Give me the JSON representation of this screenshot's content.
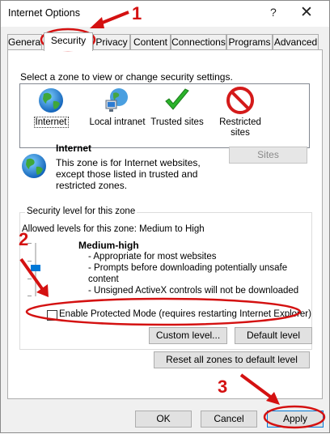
{
  "window": {
    "title": "Internet Options",
    "help_glyph": "?",
    "close_glyph": "✕"
  },
  "tabs": [
    {
      "label": "General"
    },
    {
      "label": "Security",
      "active": true
    },
    {
      "label": "Privacy"
    },
    {
      "label": "Content"
    },
    {
      "label": "Connections"
    },
    {
      "label": "Programs"
    },
    {
      "label": "Advanced"
    }
  ],
  "security": {
    "instruction": "Select a zone to view or change security settings.",
    "zones": [
      {
        "label": "Internet",
        "icon": "globe-icon",
        "selected": true
      },
      {
        "label": "Local intranet",
        "icon": "network-icon"
      },
      {
        "label": "Trusted sites",
        "icon": "checkmark-icon"
      },
      {
        "label_line1": "Restricted",
        "label_line2": "sites",
        "icon": "restricted-icon"
      }
    ],
    "zone_info": {
      "title": "Internet",
      "desc_line1": "This zone is for Internet websites,",
      "desc_line2": "except those listed in trusted and",
      "desc_line3": "restricted zones."
    },
    "sites_button": "Sites",
    "level_group": {
      "title": "Security level for this zone",
      "allowed": "Allowed levels for this zone: Medium to High",
      "level_name": "Medium-high",
      "bullets": [
        "- Appropriate for most websites",
        "- Prompts before downloading potentially unsafe",
        "content",
        "- Unsigned ActiveX controls will not be downloaded"
      ]
    },
    "protected_mode": {
      "label": "Enable Protected Mode (requires restarting Internet Explorer)",
      "checked": false
    },
    "custom_level_button": "Custom level...",
    "default_level_button": "Default level",
    "reset_all_button": "Reset all zones to default level"
  },
  "footer": {
    "ok": "OK",
    "cancel": "Cancel",
    "apply": "Apply"
  },
  "annotations": {
    "step1": "1",
    "step2": "2",
    "step3": "3"
  },
  "colors": {
    "annotation": "#d41111",
    "selection_blue": "#0078d7"
  }
}
